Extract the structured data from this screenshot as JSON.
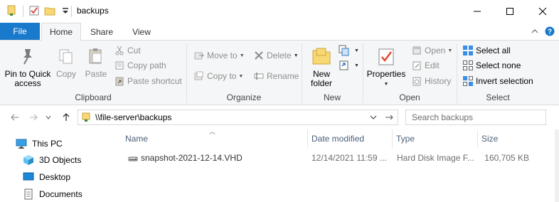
{
  "window": {
    "title": "backups"
  },
  "ribbon_tabs": {
    "file": "File",
    "home": "Home",
    "share": "Share",
    "view": "View"
  },
  "clipboard": {
    "pin_to_quick_access": "Pin to Quick access",
    "copy": "Copy",
    "paste": "Paste",
    "cut": "Cut",
    "copy_path": "Copy path",
    "paste_shortcut": "Paste shortcut",
    "label": "Clipboard"
  },
  "organize": {
    "move_to": "Move to",
    "copy_to": "Copy to",
    "delete": "Delete",
    "rename": "Rename",
    "label": "Organize"
  },
  "new_group": {
    "new_folder": "New folder",
    "label": "New"
  },
  "open_group": {
    "properties": "Properties",
    "open": "Open",
    "edit": "Edit",
    "history": "History",
    "label": "Open"
  },
  "select_group": {
    "select_all": "Select all",
    "select_none": "Select none",
    "invert_selection": "Invert selection",
    "label": "Select"
  },
  "address": {
    "path": "\\\\file-server\\backups"
  },
  "search": {
    "placeholder": "Search backups"
  },
  "nav_pane": {
    "items": [
      {
        "label": "This PC",
        "icon": "this-pc-icon"
      },
      {
        "label": "3D Objects",
        "icon": "3d-objects-icon"
      },
      {
        "label": "Desktop",
        "icon": "desktop-icon"
      },
      {
        "label": "Documents",
        "icon": "documents-icon"
      }
    ]
  },
  "file_list": {
    "columns": {
      "name": "Name",
      "date_modified": "Date modified",
      "type": "Type",
      "size": "Size"
    },
    "rows": [
      {
        "name": "snapshot-2021-12-14.VHD",
        "date_modified": "12/14/2021 11:59 ...",
        "type": "Hard Disk Image F...",
        "size": "160,705 KB"
      }
    ]
  },
  "colors": {
    "file_tab": "#1979ca",
    "ribbon_bg": "#f5f6f7",
    "header_text": "#4c607a",
    "folder_yellow": "#f8d775"
  }
}
